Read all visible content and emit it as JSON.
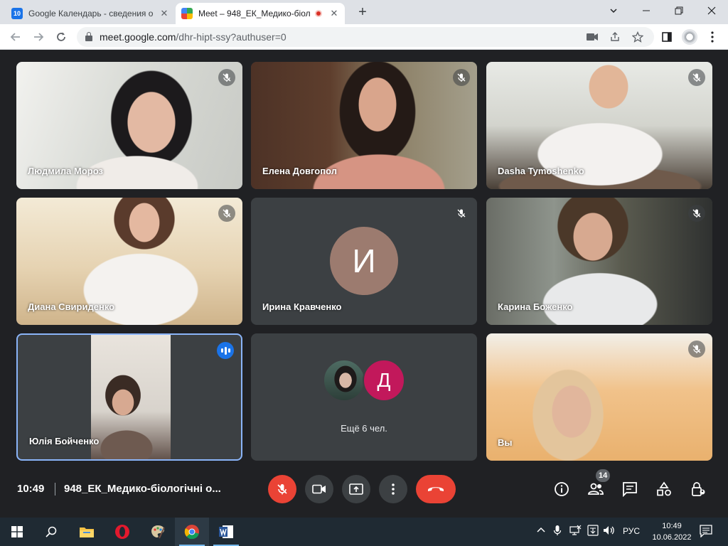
{
  "browser": {
    "tabs": [
      {
        "title": "Google Календарь - сведения о",
        "favicon": "calendar-favicon",
        "favicon_text": "10"
      },
      {
        "title": "Meet – 948_ЕК_Медико-біол",
        "favicon": "meet-favicon"
      }
    ],
    "url_host": "meet.google.com",
    "url_path": "/dhr-hipt-ssy?authuser=0",
    "close_glyph": "✕",
    "new_tab_glyph": "+"
  },
  "tiles": [
    {
      "name": "Людмила Мороз",
      "muted": true
    },
    {
      "name": "Елена Довгопол",
      "muted": true
    },
    {
      "name": "Dasha Tymoshenko",
      "muted": true
    },
    {
      "name": "Диана Свириденко",
      "muted": true
    },
    {
      "name": "Ирина Кравченко",
      "muted": true,
      "avatar_letter": "И",
      "avatar_color": "#9c7b6f"
    },
    {
      "name": "Карина Боженко",
      "muted": true
    },
    {
      "name": "Юлія Бойченко",
      "speaking": true
    },
    {
      "more_label": "Ещё 6 чел.",
      "avatar_letter": "Д",
      "avatar_color": "#c2185b"
    },
    {
      "name": "Вы",
      "muted": true
    }
  ],
  "meeting": {
    "time": "10:49",
    "title": "948_ЕК_Медико-біологічні о...",
    "participants_count": "14"
  },
  "taskbar": {
    "language": "РУС",
    "time": "10:49",
    "date": "10.06.2022"
  },
  "colors": {
    "meet_bg": "#202124",
    "tile_bg": "#3c4043",
    "danger_red": "#ea4335",
    "accent_blue": "#1a73e8"
  }
}
